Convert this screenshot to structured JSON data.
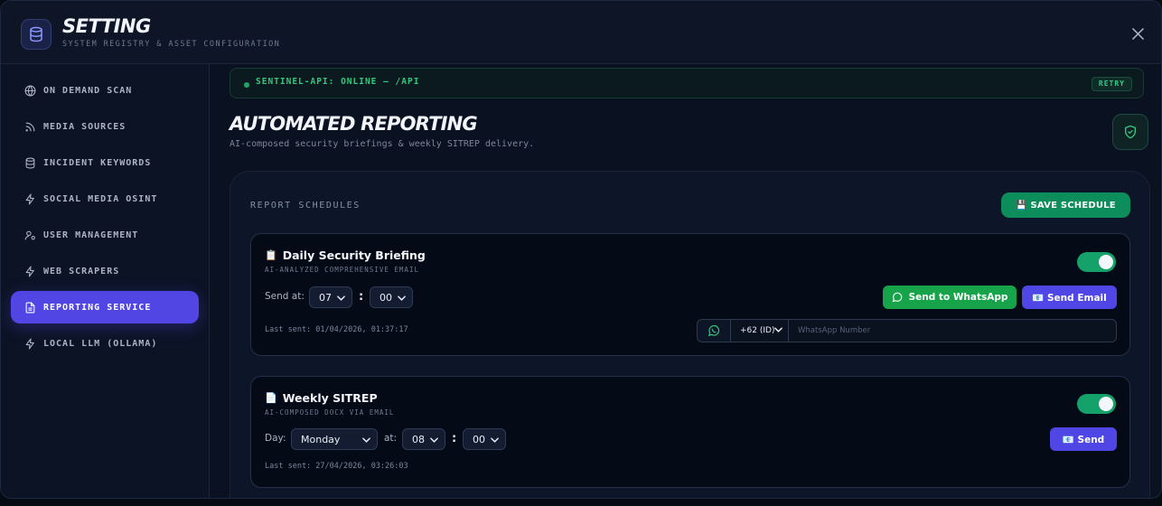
{
  "header": {
    "title": "SETTING",
    "subtitle": "SYSTEM REGISTRY & ASSET CONFIGURATION"
  },
  "sidebar": {
    "items": [
      {
        "label": "ON DEMAND SCAN",
        "icon": "globe-icon",
        "active": false
      },
      {
        "label": "MEDIA SOURCES",
        "icon": "rss-icon",
        "active": false
      },
      {
        "label": "INCIDENT KEYWORDS",
        "icon": "database-icon",
        "active": false
      },
      {
        "label": "SOCIAL MEDIA OSINT",
        "icon": "bolt-icon",
        "active": false
      },
      {
        "label": "USER MANAGEMENT",
        "icon": "user-settings-icon",
        "active": false
      },
      {
        "label": "WEB SCRAPERS",
        "icon": "bolt-icon",
        "active": false
      },
      {
        "label": "REPORTING SERVICE",
        "icon": "document-icon",
        "active": true
      },
      {
        "label": "LOCAL LLM (OLLAMA)",
        "icon": "bolt-icon",
        "active": false
      }
    ]
  },
  "api_status": {
    "text": "SENTINEL-API: ONLINE — /API",
    "retry_label": "RETRY",
    "status_color": "#1fa566"
  },
  "page": {
    "title": "AUTOMATED REPORTING",
    "subtitle": "AI-composed security briefings & weekly SITREP delivery."
  },
  "schedules": {
    "title": "REPORT SCHEDULES",
    "save_label": "💾 SAVE SCHEDULE",
    "daily": {
      "emoji": "📋",
      "title": "Daily Security Briefing",
      "subtitle": "AI-ANALYZED COMPREHENSIVE EMAIL",
      "enabled": true,
      "send_at_label": "Send at:",
      "hour": "07",
      "minute": "00",
      "last_sent": "Last sent: 01/04/2026, 01:37:17",
      "whatsapp_label": "Send to WhatsApp",
      "email_label": "📧 Send Email",
      "country_code": "+62 (ID)",
      "whatsapp_placeholder": "WhatsApp Number"
    },
    "weekly": {
      "emoji": "📄",
      "title": "Weekly SITREP",
      "subtitle": "AI-COMPOSED DOCX VIA EMAIL",
      "enabled": true,
      "day_label": "Day:",
      "day": "Monday",
      "at_label": "at:",
      "hour": "08",
      "minute": "00",
      "last_sent": "Last sent: 27/04/2026, 03:26:03",
      "send_label": "📧 Send"
    }
  },
  "colors": {
    "accent": "#5145e4",
    "success": "#15a26a",
    "whatsapp": "#17a34a"
  }
}
